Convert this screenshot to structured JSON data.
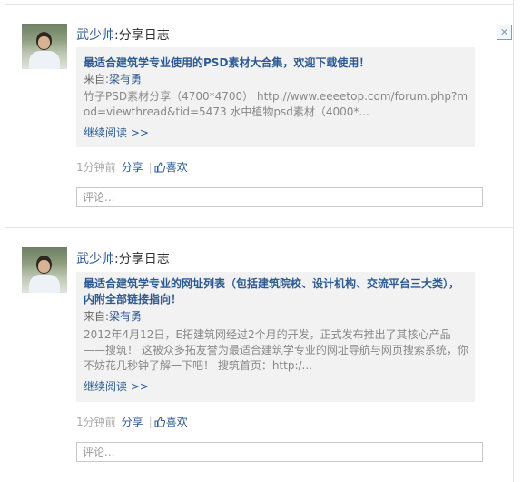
{
  "posts": [
    {
      "author": "武少帅",
      "action": ":分享日志",
      "title": "最适合建筑学专业使用的PSD素材大合集，欢迎下载使用！",
      "from_label": "来自:",
      "from_name": "梁有勇",
      "description": "竹子PSD素材分享（4700*4700） http://www.eeeetop.com/forum.php?mod=viewthread&tid=5473 水中植物psd素材（4000*...",
      "read_more": "继续阅读 >>",
      "time": "1分钟前",
      "share_label": "分享",
      "like_label": "喜欢",
      "comment_placeholder": "评论..."
    },
    {
      "author": "武少帅",
      "action": ":分享日志",
      "title": "最适合建筑学专业的网址列表（包括建筑院校、设计机构、交流平台三大类），内附全部链接指向！",
      "from_label": "来自:",
      "from_name": "梁有勇",
      "description": "2012年4月12日，E拓建筑网经过2个月的开发，正式发布推出了其核心产品——搜筑！ 这被众多拓友誉为最适合建筑学专业的网址导航与网页搜索系统，你不妨花几秒钟了解一下吧！ 搜筑首页：http:/...",
      "read_more": "继续阅读 >>",
      "time": "1分钟前",
      "share_label": "分享",
      "like_label": "喜欢",
      "comment_placeholder": "评论..."
    }
  ],
  "icons": {
    "close": "close-icon",
    "like": "thumbs-up-icon"
  },
  "colors": {
    "link": "#2e5a92",
    "card_bg": "#f2f2f2",
    "muted": "#aaaaaa"
  }
}
